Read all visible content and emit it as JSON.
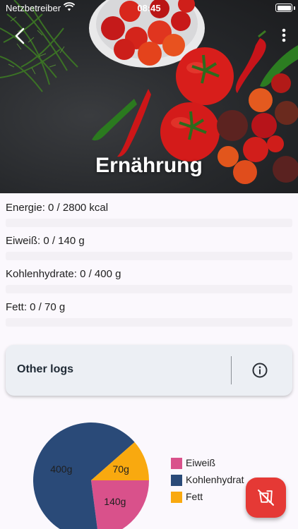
{
  "status_bar": {
    "carrier": "Netzbetreiber",
    "time": "08:45"
  },
  "header": {
    "title": "Ernährung"
  },
  "stats": [
    {
      "label": "Energie: 0 / 2800 kcal"
    },
    {
      "label": "Eiweiß: 0 / 140 g"
    },
    {
      "label": "Kohlenhydrate: 0 / 400 g"
    },
    {
      "label": "Fett: 0 / 70 g"
    }
  ],
  "other_logs": {
    "title": "Other logs"
  },
  "chart_data": {
    "type": "pie",
    "slices": [
      {
        "name": "Eiweiß",
        "value": 140,
        "label": "140g",
        "color": "#d9518b"
      },
      {
        "name": "Kohlenhydrate",
        "value": 400,
        "label": "400g",
        "color": "#2a4a78"
      },
      {
        "name": "Fett",
        "value": 70,
        "label": "70g",
        "color": "#f9a90f"
      }
    ],
    "legend": [
      "Eiweiß",
      "Kohlenhydrat",
      "Fett"
    ],
    "legend_placement": "right"
  },
  "colors": {
    "fab": "#e53935",
    "card": "#eceff4"
  },
  "icons": {
    "back": "chevron-left-icon",
    "more": "more-vert-icon",
    "info": "info-icon",
    "fab": "no-food-icon"
  }
}
